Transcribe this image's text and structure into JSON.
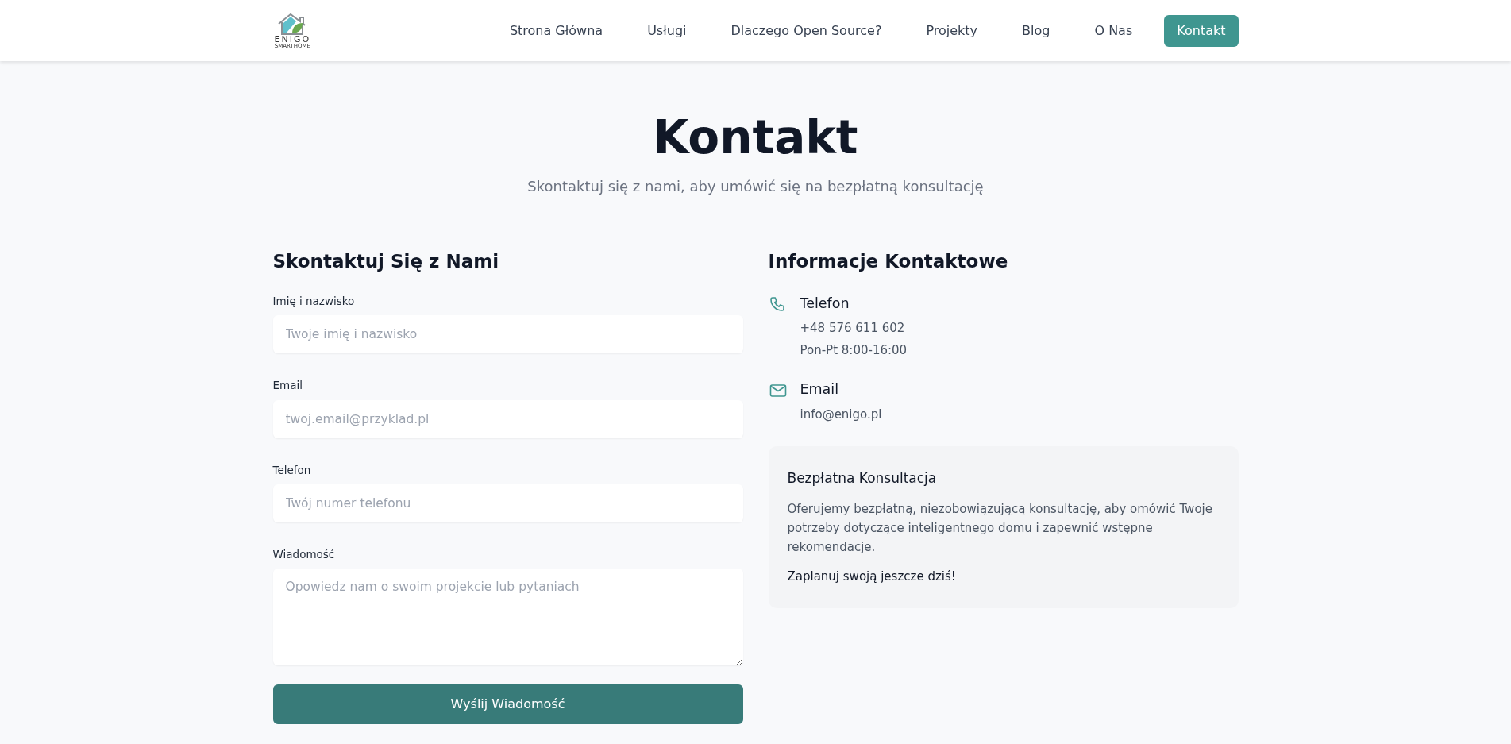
{
  "logo": {
    "name": "ENIGO",
    "tagline": "SMARTHOME"
  },
  "nav": [
    {
      "label": "Strona Główna",
      "selected": false
    },
    {
      "label": "Usługi",
      "selected": false
    },
    {
      "label": "Dlaczego Open Source?",
      "selected": false
    },
    {
      "label": "Projekty",
      "selected": false
    },
    {
      "label": "Blog",
      "selected": false
    },
    {
      "label": "O Nas",
      "selected": false
    },
    {
      "label": "Kontakt",
      "selected": true
    }
  ],
  "header": {
    "title": "Kontakt",
    "subtitle": "Skontaktuj się z nami, aby umówić się na bezpłatną konsultację"
  },
  "form": {
    "title": "Skontaktuj Się z Nami",
    "fields": [
      {
        "kind": "input",
        "label": "Imię i nazwisko",
        "placeholder": "Twoje imię i nazwisko"
      },
      {
        "kind": "input",
        "label": "Email",
        "placeholder": "twoj.email@przyklad.pl"
      },
      {
        "kind": "input",
        "label": "Telefon",
        "placeholder": "Twój numer telefonu"
      },
      {
        "kind": "textarea",
        "label": "Wiadomość",
        "placeholder": "Opowiedz nam o swoim projekcie lub pytaniach"
      }
    ],
    "submit": "Wyślij Wiadomość"
  },
  "info": {
    "title": "Informacje Kontaktowe",
    "items": [
      {
        "kind": "phone",
        "title": "Telefon",
        "lines": [
          "+48 576 611 602",
          "Pon-Pt 8:00-16:00"
        ]
      },
      {
        "kind": "email",
        "title": "Email",
        "lines": [
          "info@enigo.pl"
        ]
      }
    ],
    "consultation": {
      "title": "Bezpłatna Konsultacja",
      "text": "Oferujemy bezpłatną, niezobowiązującą konsultację, aby omówić Twoje potrzeby dotyczące inteligentnego domu i zapewnić wstępne rekomendacje.",
      "cta": "Zaplanuj swoją jeszcze dziś!"
    }
  }
}
